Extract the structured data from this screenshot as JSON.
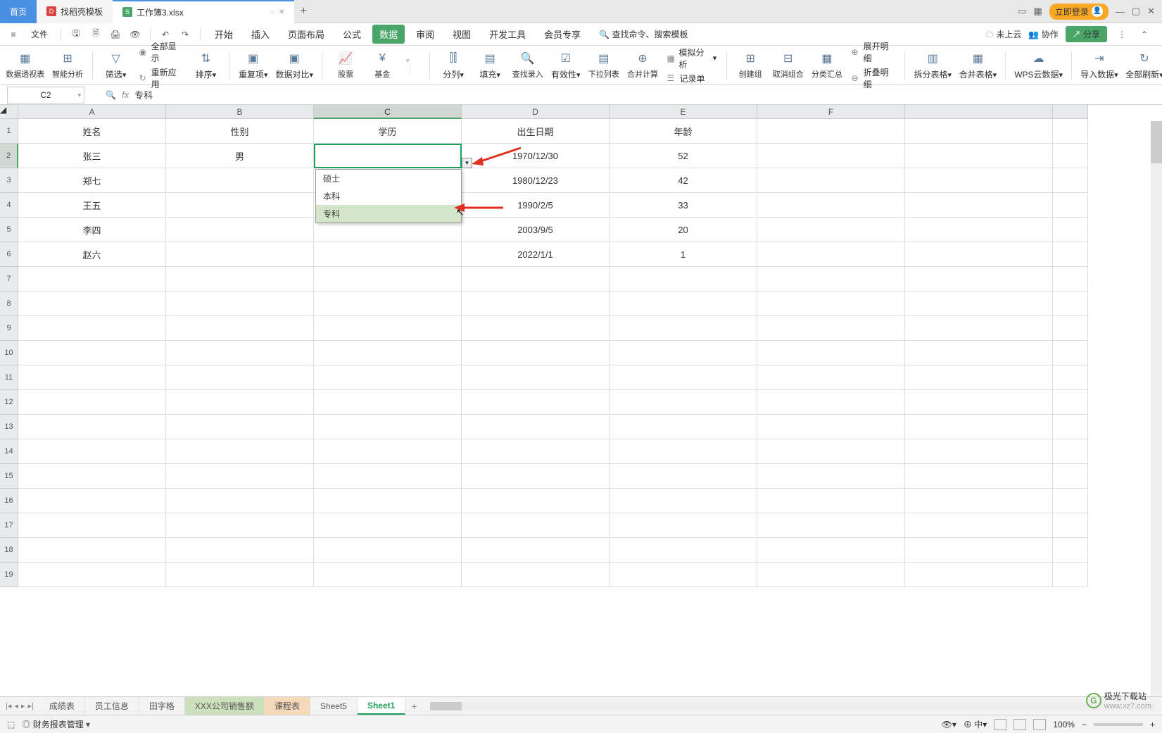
{
  "titlebar": {
    "home_tab": "首页",
    "template_tab": "找稻壳模板",
    "file_tab": "工作簿3.xlsx",
    "new_tab": "+",
    "login": "立即登录"
  },
  "menubar": {
    "file": "文件",
    "tabs": [
      "开始",
      "插入",
      "页面布局",
      "公式",
      "数据",
      "审阅",
      "视图",
      "开发工具",
      "会员专享"
    ],
    "active_tab": "数据",
    "search_placeholder": "查找命令、搜索模板",
    "cloud": "未上云",
    "collab": "协作",
    "share": "分享"
  },
  "ribbon": {
    "pivot": "数据透视表",
    "smart": "智能分析",
    "filter": "筛选",
    "show_all": "全部显示",
    "reapply": "重新应用",
    "sort": "排序",
    "dup": "重复项",
    "compare": "数据对比",
    "stock": "股票",
    "fund": "基金",
    "split": "分列",
    "fill": "填充",
    "findrec": "查找录入",
    "validity": "有效性",
    "dropdown": "下拉列表",
    "consolidate": "合并计算",
    "scenario": "模拟分析",
    "record": "记录单",
    "group": "创建组",
    "ungroup": "取消组合",
    "subtotal": "分类汇总",
    "expand": "展开明细",
    "collapse": "折叠明细",
    "splittable": "拆分表格",
    "mergetable": "合并表格",
    "wpscloud": "WPS云数据",
    "import": "导入数据",
    "refresh": "全部刷新"
  },
  "formula": {
    "cell_ref": "C2",
    "fx_label": "fx",
    "value": "专科"
  },
  "columns": [
    "A",
    "B",
    "C",
    "D",
    "E",
    "F"
  ],
  "rows": [
    "1",
    "2",
    "3",
    "4",
    "5",
    "6",
    "7",
    "8",
    "9",
    "10",
    "11",
    "12",
    "13",
    "14",
    "15",
    "16",
    "17",
    "18",
    "19"
  ],
  "data": {
    "r1": {
      "A": "姓名",
      "B": "性别",
      "C": "学历",
      "D": "出生日期",
      "E": "年龄"
    },
    "r2": {
      "A": "张三",
      "B": "男",
      "C": "专科",
      "D": "1970/12/30",
      "E": "52"
    },
    "r3": {
      "A": "郑七",
      "B": "",
      "C": "",
      "D": "1980/12/23",
      "E": "42"
    },
    "r4": {
      "A": "王五",
      "B": "",
      "C": "",
      "D": "1990/2/5",
      "E": "33"
    },
    "r5": {
      "A": "李四",
      "B": "",
      "C": "",
      "D": "2003/9/5",
      "E": "20"
    },
    "r6": {
      "A": "赵六",
      "B": "",
      "C": "",
      "D": "2022/1/1",
      "E": "1"
    }
  },
  "dropdown": {
    "options": [
      "硕士",
      "本科",
      "专科"
    ],
    "hover_index": 2
  },
  "sheets": {
    "nav": [
      "|◂",
      "◂",
      "▸",
      "▸|"
    ],
    "tabs": [
      "成绩表",
      "员工信息",
      "田字格",
      "XXX公司销售额",
      "课程表",
      "Sheet5",
      "Sheet1"
    ],
    "active": "Sheet1",
    "hl": "XXX公司销售额",
    "hl2": "课程表"
  },
  "statusbar": {
    "manage": "财务报表管理",
    "zoom": "100%"
  },
  "watermark": {
    "text": "极光下载站",
    "url": "www.xz7.com"
  }
}
